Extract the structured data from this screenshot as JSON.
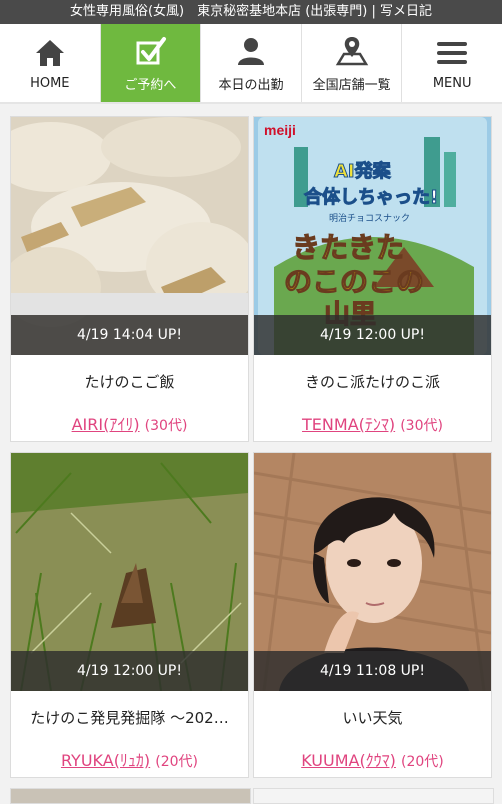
{
  "header": {
    "title": "女性専用風俗(女風)　東京秘密基地本店 (出張専門) | 写メ日記"
  },
  "nav": [
    {
      "label": "HOME",
      "icon": "home-icon"
    },
    {
      "label": "ご予約へ",
      "icon": "checkbox-icon"
    },
    {
      "label": "本日の出勤",
      "icon": "person-icon"
    },
    {
      "label": "全国店舗一覧",
      "icon": "map-pin-icon"
    },
    {
      "label": "MENU",
      "icon": "hamburger-icon"
    }
  ],
  "colors": {
    "accent_green": "#6fb93f",
    "name_pink": "#e0447f",
    "header_bg": "#4a4a4a"
  },
  "posts": [
    {
      "uptime": "4/19 14:04 UP!",
      "title": "たけのこご飯",
      "name": "AIRI(ｱｲﾘ)",
      "age": "(30代)"
    },
    {
      "uptime": "4/19 12:00 UP!",
      "title": "きのこ派たけのこ派",
      "name": "TENMA(ﾃﾝﾏ)",
      "age": "(30代)",
      "photo_text": {
        "brand": "meiji",
        "badge": "AI発案",
        "headline": "合体しちゃった!",
        "sub": "明治チョコスナック",
        "product1": "きたきた",
        "product2": "のこのこの",
        "product3": "山里"
      }
    },
    {
      "uptime": "4/19 12:00 UP!",
      "title": "たけのこ発見発掘隊 〜202…",
      "name": "RYUKA(ﾘｭｶ)",
      "age": "(20代)"
    },
    {
      "uptime": "4/19 11:08 UP!",
      "title": "いい天気",
      "name": "KUUMA(ｸｳﾏ)",
      "age": "(20代)"
    }
  ]
}
